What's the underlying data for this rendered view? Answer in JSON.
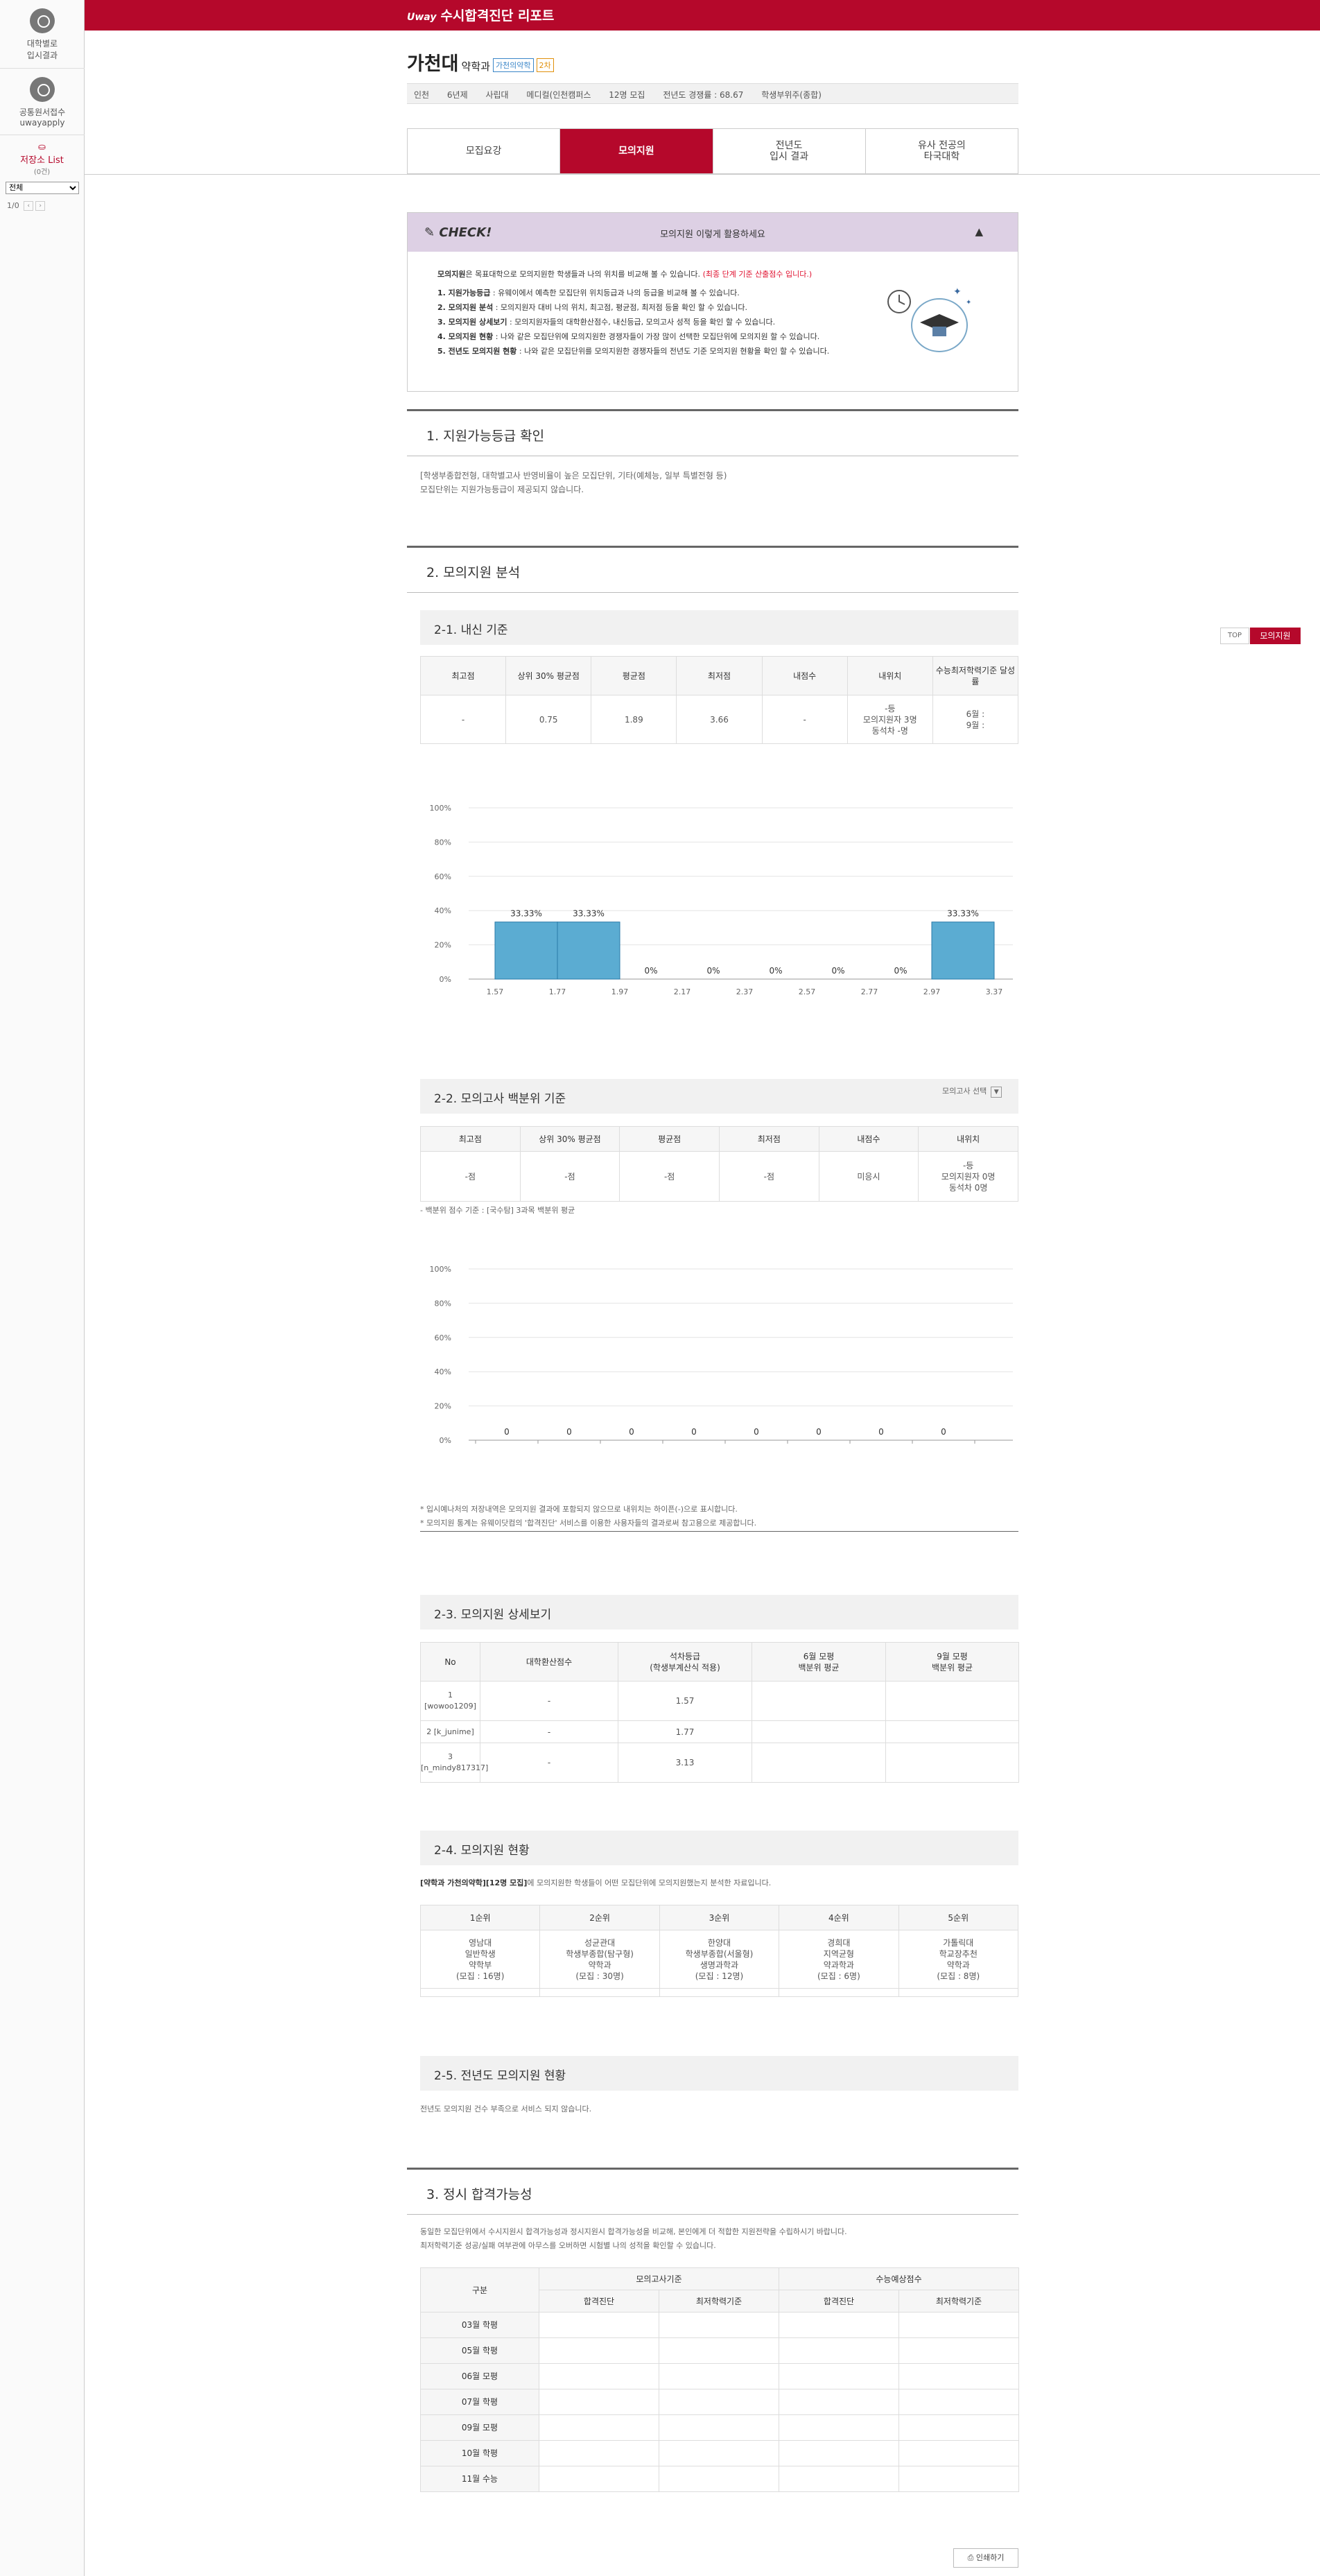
{
  "sidebar": {
    "items": [
      {
        "label1": "대학별로",
        "label2": "입시결과"
      },
      {
        "label1": "공통원서접수",
        "label2": "uwayapply"
      }
    ],
    "store_label": "저장소 List",
    "store_sub": "(0건)",
    "select_value": "전체",
    "pager": "1/0"
  },
  "topbar": {
    "logo": "Uway",
    "title": "수시합격진단 리포트"
  },
  "header": {
    "university": "가천대",
    "major": "약학과",
    "badge1": "가천의약학",
    "badge2": "2차",
    "info": [
      "인천",
      "6년제",
      "사립대",
      "메디컬(인천캠퍼스",
      "12명 모집",
      "전년도 경쟁률 : 68.67",
      "학생부위주(종합)"
    ]
  },
  "tabs": [
    {
      "l1": "모집요강",
      "l2": ""
    },
    {
      "l1": "모의지원",
      "l2": ""
    },
    {
      "l1": "전년도",
      "l2": "입시 결과"
    },
    {
      "l1": "유사 전공의",
      "l2": "타국대학"
    }
  ],
  "check": {
    "logo": "CHECK!",
    "head": "모의지원 이렇게 활용하세요",
    "toggle": "▲",
    "intro_b": "모의지원",
    "intro": "은 목표대학으로 모의지원한 학생들과 나의 위치를 비교해 볼 수 있습니다.",
    "intro_red": "(최종 단계 기준 산출점수 입니다.)",
    "lines": [
      {
        "b": "1. 지원가능등급",
        "t": " : 유웨이에서 예측한 모집단위 위치등급과 나의 등급을 비교해 볼 수 있습니다."
      },
      {
        "b": "2. 모의지원 분석",
        "t": " : 모의지원자 대비 나의 위치, 최고점, 평균점, 최저점 등을 확인 할 수 있습니다."
      },
      {
        "b": "3. 모의지원 상세보기",
        "t": " : 모의지원자들의 대학환산점수, 내신등급, 모의고사 성적 등을 확인 할 수 있습니다."
      },
      {
        "b": "4. 모의지원 현황",
        "t": " : 나와 같은 모집단위에 모의지원한 경쟁자들이 가장 많이 선택한 모집단위에 모의지원 할 수 있습니다."
      },
      {
        "b": "5. 전년도 모의지원 현황",
        "t": " : 나와 같은 모집단위를 모의지원한 경쟁자들의 전년도 기준 모의지원 현황을 확인 할 수 있습니다."
      }
    ]
  },
  "s1": {
    "title": "1. 지원가능등급 확인",
    "note1": "[학생부종합전형, 대학별고사 반영비율이 높은 모집단위, 기타(예체능, 일부 특별전형 등)",
    "note2": "모집단위는 지원가능등급이 제공되지 않습니다."
  },
  "s2": {
    "title": "2. 모의지원 분석"
  },
  "s21": {
    "title": "2-1. 내신 기준",
    "headers": [
      "최고점",
      "상위 30% 평균점",
      "평균점",
      "최저점",
      "내점수",
      "내위치",
      "수능최저학력기준 달성률"
    ],
    "values": [
      "-",
      "0.75",
      "1.89",
      "3.66",
      "-"
    ],
    "pos": [
      "-등",
      "모의지원자 3명",
      "동석차 -명"
    ],
    "csat": [
      "6월 :",
      "9월 :"
    ]
  },
  "chart_data": [
    {
      "type": "bar",
      "categories": [
        "1.57",
        "1.77",
        "1.97",
        "2.17",
        "2.37",
        "2.57",
        "2.77",
        "2.97",
        "3.37"
      ],
      "x_ticks": [
        "1.57",
        "1.77",
        "1.97",
        "2.17",
        "2.37",
        "2.57",
        "2.77",
        "2.97",
        "3.37"
      ],
      "values": [
        33.33,
        33.33,
        0,
        0,
        0,
        0,
        0,
        33.33
      ],
      "labels": [
        "33.33%",
        "33.33%",
        "0%",
        "0%",
        "0%",
        "0%",
        "0%",
        "33.33%"
      ],
      "y_ticks": [
        "100%",
        "80%",
        "60%",
        "40%",
        "20%",
        "0%"
      ],
      "ylim": [
        0,
        100
      ],
      "color": "#5bacd2"
    },
    {
      "type": "bar",
      "categories": [
        "",
        "",
        "",
        "",
        "",
        "",
        "",
        ""
      ],
      "values": [
        0,
        0,
        0,
        0,
        0,
        0,
        0,
        0
      ],
      "labels": [
        "0",
        "0",
        "0",
        "0",
        "0",
        "0",
        "0",
        "0"
      ],
      "y_ticks": [
        "100%",
        "80%",
        "60%",
        "40%",
        "20%",
        "0%"
      ],
      "ylim": [
        0,
        100
      ],
      "color": "#5bacd2"
    }
  ],
  "s22": {
    "title": "2-2. 모의고사 백분위 기준",
    "select": "모의고사 선택",
    "headers": [
      "최고점",
      "상위 30% 평균점",
      "평균점",
      "최저점",
      "내점수",
      "내위치"
    ],
    "values": [
      "-점",
      "-점",
      "-점",
      "-점",
      "미응시"
    ],
    "pos": [
      "-등",
      "모의지원자 0명",
      "동석차 0명"
    ],
    "note": "- 백분위 점수 기준 : [국수탐] 3과목 백분위 평균"
  },
  "notes": [
    "* 입시예나처의 저장내역은 모의지원 결과에 포함되지 않으므로 내위치는 하이픈(-)으로 표시합니다.",
    "* 모의지원 통계는 유웨이닷컴의 '합격진단' 서비스를 이용한 사용자들의 결과로써 참고용으로 제공합니다."
  ],
  "s23": {
    "title": "2-3. 모의지원 상세보기",
    "headers": [
      "No",
      "대학환산점수",
      "석차등급\n(학생부계산식 적용)",
      "6월 모평\n백분위 평균",
      "9월 모평\n백분위 평균"
    ],
    "rows": [
      {
        "no": "1\n[wowoo1209]",
        "score": "-",
        "grade": "1.57"
      },
      {
        "no": "2 [k_junime]",
        "score": "-",
        "grade": "1.77"
      },
      {
        "no": "3\n[n_mindy817317]",
        "score": "-",
        "grade": "3.13"
      }
    ]
  },
  "s24": {
    "title": "2-4. 모의지원 현황",
    "desc_b": "[약학과 가천의약학][12명 모집]",
    "desc": "에 모의지원한 학생들이 어떤 모집단위에 모의지원했는지 분석한 자료입니다.",
    "headers": [
      "1순위",
      "2순위",
      "3순위",
      "4순위",
      "5순위"
    ],
    "cells": [
      [
        "영남대",
        "일반학생",
        "약학부",
        "(모집 : 16명)"
      ],
      [
        "성균관대",
        "학생부종합(탐구형)",
        "약학과",
        "(모집 : 30명)"
      ],
      [
        "한양대",
        "학생부종합(서울형)",
        "생명과학과",
        "(모집 : 12명)"
      ],
      [
        "경희대",
        "지역균형",
        "약과학과",
        "(모집 : 6명)"
      ],
      [
        "가톨릭대",
        "학교장추천",
        "약학과",
        "(모집 : 8명)"
      ]
    ]
  },
  "s25": {
    "title": "2-5. 전년도 모의지원 현황",
    "note": "전년도 모의지원 건수 부족으로 서비스 되지 않습니다."
  },
  "s3": {
    "title": "3. 정시 합격가능성",
    "note1": "동일한 모집단위에서 수시지원시 합격가능성과 정시지원시 합격가능성을 비교해, 본인에게 더 적합한 지원전략을 수립하시기 바랍니다.",
    "note2": "최저학력기준 성공/실패 여부관에 아무스를 오버하면 시험별 나의 성적을 확인할 수 있습니다.",
    "col_group": "구분",
    "group1": "모의고사기준",
    "group2": "수능예상점수",
    "sub": [
      "합격진단",
      "최저학력기준",
      "합격진단",
      "최저학력기준"
    ],
    "rows": [
      "03월 학평",
      "05월 학평",
      "06월 모평",
      "07월 학평",
      "09월 모평",
      "10월 학평",
      "11월 수능"
    ]
  },
  "float": {
    "top": "TOP",
    "mock": "모의지원"
  },
  "print": "인쇄하기"
}
